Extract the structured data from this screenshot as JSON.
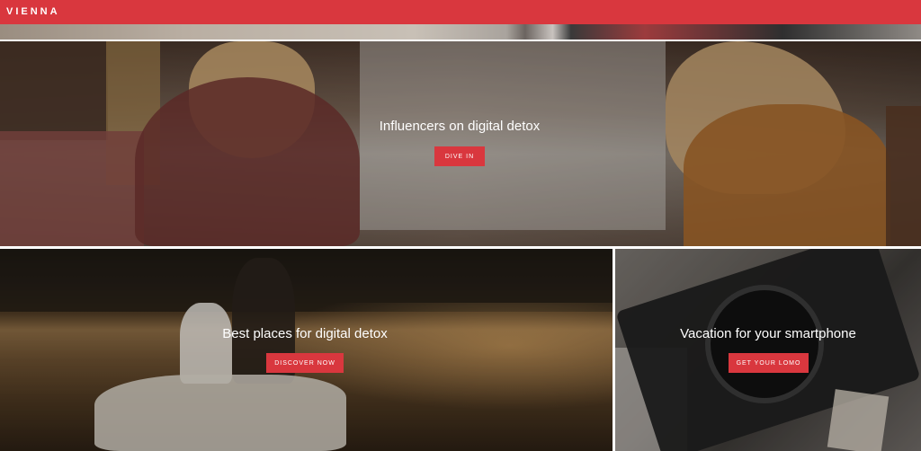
{
  "header": {
    "brand": "VIENNA",
    "accent_color": "#d9373e"
  },
  "panels": [
    {
      "title": "Influencers on digital detox",
      "button_label": "DIVE IN",
      "image": "two women at a cafe table"
    },
    {
      "title": "Best places for digital detox",
      "button_label": "DISCOVER NOW",
      "image": "couple in a boat on a lake at sunset"
    },
    {
      "title": "Vacation for your smartphone",
      "button_label": "GET YOUR LOMO",
      "image": "Lomo'Instant camera"
    }
  ]
}
